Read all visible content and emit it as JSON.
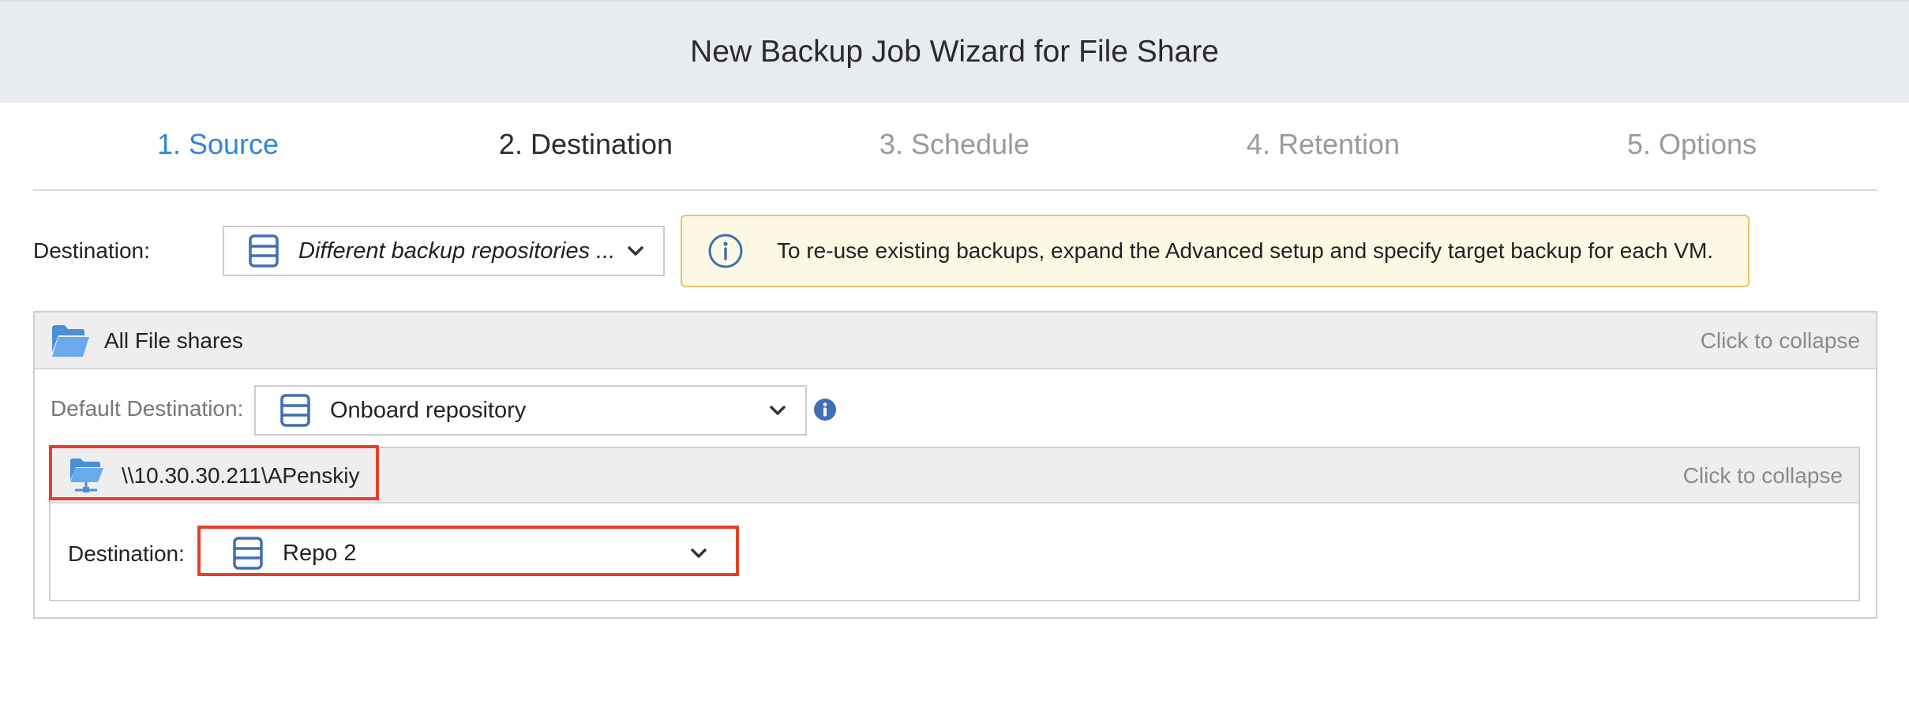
{
  "wizard": {
    "title": "New Backup Job Wizard for File Share"
  },
  "steps": [
    {
      "label": "1. Source",
      "state": "done"
    },
    {
      "label": "2. Destination",
      "state": "active"
    },
    {
      "label": "3. Schedule",
      "state": "pending"
    },
    {
      "label": "4. Retention",
      "state": "pending"
    },
    {
      "label": "5. Options",
      "state": "pending"
    }
  ],
  "destination": {
    "label": "Destination:",
    "selected": "Different backup repositories ...",
    "icon": "database-icon"
  },
  "notice": {
    "icon": "info-circle-icon",
    "text": "To re-use existing backups, expand the Advanced setup and specify target backup for each VM."
  },
  "all_shares": {
    "title": "All File shares",
    "icon": "open-folder-icon",
    "collapse_label": "Click to collapse",
    "default_destination_label": "Default Destination:",
    "default_destination_value": "Onboard repository"
  },
  "share": {
    "path": "\\\\10.30.30.211\\APenskiy",
    "icon": "network-folder-icon",
    "collapse_label": "Click to collapse",
    "destination_label": "Destination:",
    "destination_value": "Repo 2"
  },
  "colors": {
    "accent": "#2f86d8",
    "highlight": "#e53f2d",
    "notice_bg": "#fdf8e4",
    "notice_border": "#e9c46a",
    "icon_blue": "#3f6fb5"
  }
}
